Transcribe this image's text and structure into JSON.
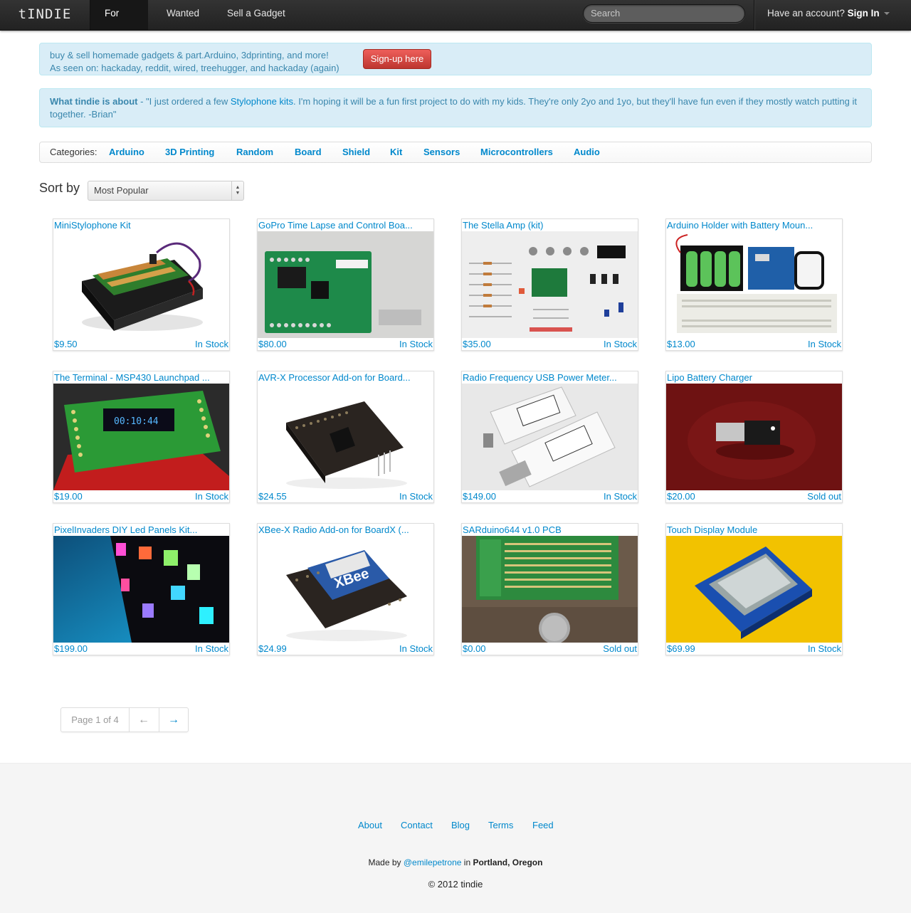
{
  "navbar": {
    "brand": "tINDIE",
    "items": [
      {
        "label": "For Sale",
        "active": true
      },
      {
        "label": "Wanted",
        "active": false
      },
      {
        "label": "Sell a Gadget",
        "active": false
      }
    ],
    "search_placeholder": "Search",
    "account_text": "Have an account?",
    "signin_label": "Sign In"
  },
  "banner": {
    "line1": "buy & sell homemade gadgets & part.Arduino, 3dprinting, and more!",
    "line2": "As seen on: hackaday, reddit, wired, treehugger, and hackaday (again)",
    "signup_label": "Sign-up here"
  },
  "about": {
    "heading": "What tindie is about",
    "text_before": " - \"I just ordered a few ",
    "link": "Stylophone kits",
    "text_after": ". I'm hoping it will be a fun first project to do with my kids. They're only 2yo and 1yo, but they'll have fun even if they mostly watch putting it together. -Brian\""
  },
  "categories": {
    "label": "Categories:",
    "items": [
      "Arduino",
      "3D Printing",
      "Random",
      "Board",
      "Shield",
      "Kit",
      "Sensors",
      "Microcontrollers",
      "Audio"
    ]
  },
  "sort": {
    "label": "Sort by",
    "selected": "Most Popular"
  },
  "products": [
    {
      "title": "MiniStylophone Kit",
      "price": "$9.50",
      "stock": "In Stock",
      "icon": "ministylophone-photo"
    },
    {
      "title": "GoPro Time Lapse and Control Boa...",
      "price": "$80.00",
      "stock": "In Stock",
      "icon": "gopro-board-photo"
    },
    {
      "title": "The Stella Amp (kit)",
      "price": "$35.00",
      "stock": "In Stock",
      "icon": "stella-amp-kit-photo"
    },
    {
      "title": "Arduino Holder with Battery Moun...",
      "price": "$13.00",
      "stock": "In Stock",
      "icon": "arduino-holder-photo"
    },
    {
      "title": "The Terminal - MSP430 Launchpad ...",
      "price": "$19.00",
      "stock": "In Stock",
      "icon": "terminal-launchpad-photo"
    },
    {
      "title": "AVR-X Processor Add-on for Board...",
      "price": "$24.55",
      "stock": "In Stock",
      "icon": "avr-x-addon-photo"
    },
    {
      "title": "Radio Frequency USB Power Meter...",
      "price": "$149.00",
      "stock": "In Stock",
      "icon": "rf-usb-power-meter-photo"
    },
    {
      "title": "Lipo Battery Charger",
      "price": "$20.00",
      "stock": "Sold out",
      "icon": "lipo-charger-photo"
    },
    {
      "title": "PixelInvaders DIY Led Panels Kit...",
      "price": "$199.00",
      "stock": "In Stock",
      "icon": "led-panels-photo"
    },
    {
      "title": "XBee-X Radio Add-on for BoardX (...",
      "price": "$24.99",
      "stock": "In Stock",
      "icon": "xbee-addon-photo"
    },
    {
      "title": "SARduino644 v1.0 PCB",
      "price": "$0.00",
      "stock": "Sold out",
      "icon": "sarduino-pcb-photo"
    },
    {
      "title": "Touch Display Module",
      "price": "$69.99",
      "stock": "In Stock",
      "icon": "touch-display-photo"
    }
  ],
  "pagination": {
    "page_text": "Page 1 of 4",
    "prev": "←",
    "next": "→"
  },
  "footer": {
    "links": [
      "About",
      "Contact",
      "Blog",
      "Terms",
      "Feed"
    ],
    "made_by_prefix": "Made by ",
    "made_by_handle": "@emilepetrone",
    "made_by_in": " in ",
    "made_by_place": "Portland, Oregon",
    "copyright": "© 2012 tindie"
  },
  "colors": {
    "link": "#0088cc",
    "alert_bg": "#d9edf7",
    "alert_text": "#3a87ad",
    "signup_button": "#bd362f",
    "navbar": "#222222"
  }
}
